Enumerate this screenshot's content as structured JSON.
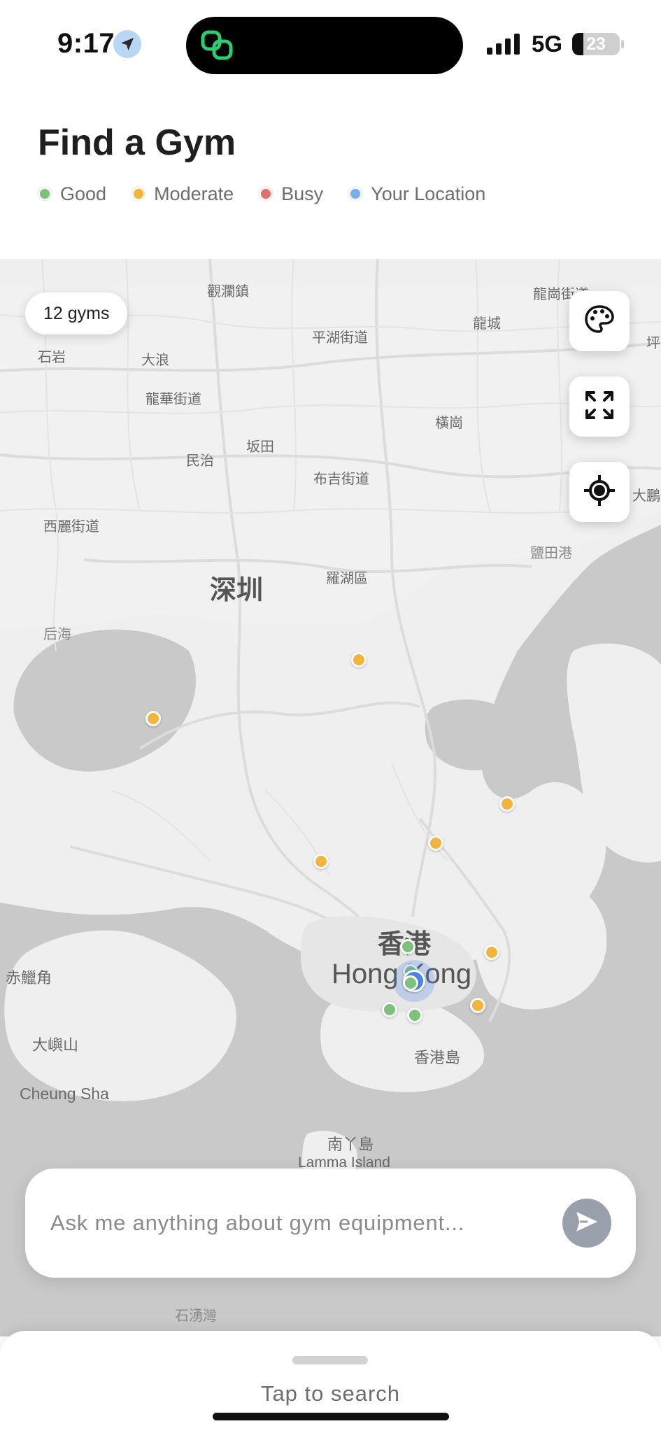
{
  "status_bar": {
    "time": "9:17",
    "network": "5G",
    "battery": "23",
    "battery_level": 0.23
  },
  "header": {
    "title": "Find a Gym",
    "legend": [
      {
        "label": "Good",
        "color": "#7cc27a"
      },
      {
        "label": "Moderate",
        "color": "#f3b43e"
      },
      {
        "label": "Busy",
        "color": "#e07070"
      },
      {
        "label": "Your Location",
        "color": "#7aaeea"
      }
    ]
  },
  "map": {
    "gym_count": "12 gyms",
    "buttons": [
      {
        "name": "theme-palette-button",
        "icon": "palette-icon"
      },
      {
        "name": "fullscreen-button",
        "icon": "expand-icon"
      },
      {
        "name": "recenter-button",
        "icon": "locate-icon"
      }
    ],
    "place_labels": {
      "guanlan": "觀瀾鎮",
      "longgang": "龍崗街道",
      "longcheng": "龍城",
      "ping": "坪",
      "shiyan": "石岩",
      "dalang": "大浪",
      "pinghu": "平湖街道",
      "longhua": "龍華街道",
      "henggang": "橫崗",
      "bantian": "坂田",
      "minzhi": "民治",
      "buji": "布吉街道",
      "dapeng": "大鵬",
      "xili": "西麗街道",
      "yantian": "鹽田港",
      "shenzhen": "深圳",
      "luohu": "羅湖區",
      "houhai": "后海",
      "xianggang": "香港",
      "hongkong": "Hong Kong",
      "chilapkok": "赤鱲角",
      "daiyushan": "大嶼山",
      "hkisland": "香港島",
      "cheungsha": "Cheung Sha",
      "namadao": "南丫島",
      "lamma": "Lamma Island",
      "shekpik": "石湧灣"
    }
  },
  "chat": {
    "placeholder": "Ask me anything about gym equipment..."
  },
  "sheet": {
    "label": "Tap to search"
  }
}
